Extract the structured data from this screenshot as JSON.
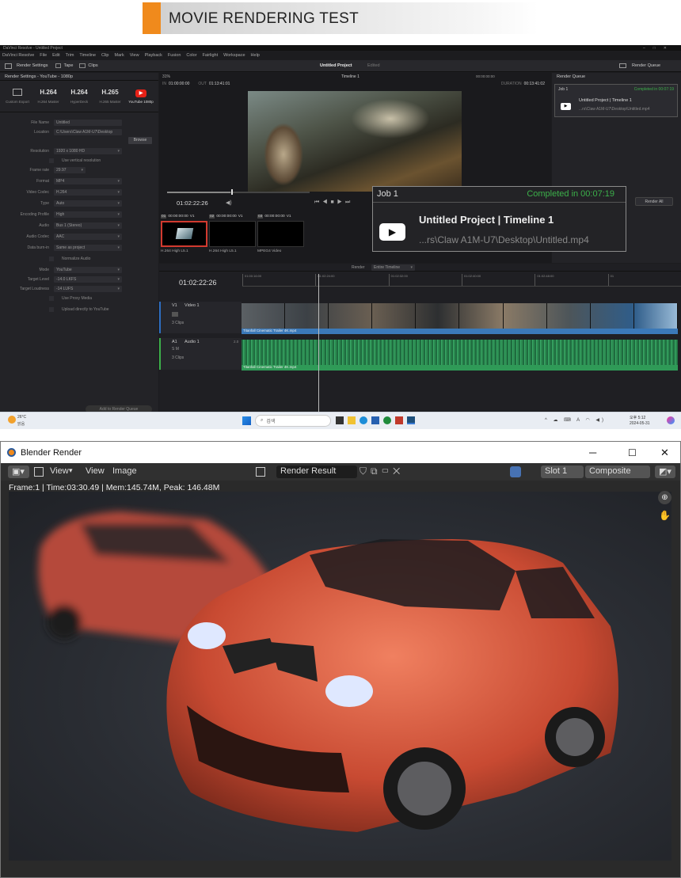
{
  "banner": {
    "title": "MOVIE RENDERING TEST"
  },
  "resolve": {
    "app_title": "DaVinci Resolve - Untitled Project",
    "menu": [
      "DaVinci Resolve",
      "File",
      "Edit",
      "Trim",
      "Timeline",
      "Clip",
      "Mark",
      "View",
      "Playback",
      "Fusion",
      "Color",
      "Fairlight",
      "Workspace",
      "Help"
    ],
    "toolbar": {
      "render_settings": "Render Settings",
      "tape": "Tape",
      "clips": "Clips",
      "project": "Untitled Project",
      "edited": "Edited",
      "timeline": "Timeline 1",
      "render_queue": "Render Queue"
    },
    "render_settings": {
      "header": "Render Settings - YouTube - 1080p",
      "presets": [
        {
          "big": "",
          "small": "Custom Export"
        },
        {
          "big": "H.264",
          "small": "H.264 Master"
        },
        {
          "big": "H.264",
          "small": "HyperDeck"
        },
        {
          "big": "H.265",
          "small": "H.265 Master"
        },
        {
          "big": "",
          "small": "YouTube 1080p"
        }
      ],
      "fields": [
        {
          "label": "File Name",
          "value": "Untitled"
        },
        {
          "label": "Location",
          "value": "C:\\Users\\Claw A1M-U7\\Desktop"
        },
        {
          "label": "Resolution",
          "value": "1920 x 1080 HD"
        },
        {
          "label": "",
          "value": "Use vertical resolution"
        },
        {
          "label": "Frame rate",
          "value": "29.97"
        },
        {
          "label": "Format",
          "value": "MP4"
        },
        {
          "label": "Video Codec",
          "value": "H.264"
        },
        {
          "label": "Type",
          "value": "Auto"
        },
        {
          "label": "Encoding Profile",
          "value": "High"
        },
        {
          "label": "Audio",
          "value": "Bus 1 (Stereo)"
        },
        {
          "label": "Audio Codec",
          "value": "AAC"
        },
        {
          "label": "Data burn-in",
          "value": "Same as project"
        },
        {
          "label": "",
          "value": "Normalize Audio"
        },
        {
          "label": "Mode",
          "value": "YouTube"
        },
        {
          "label": "Target Level",
          "value": "-14.0   LKFS"
        },
        {
          "label": "Target Loudness",
          "value": "-14   LUFS"
        },
        {
          "label": "",
          "value": "Use Proxy Media"
        },
        {
          "label": "",
          "value": "Upload directly to YouTube"
        }
      ],
      "browse": "Browse",
      "add_queue": "Add to Render Queue"
    },
    "viewer": {
      "zoom": "31%",
      "in_label": "IN",
      "in": "01:00:00:00",
      "out_label": "OUT",
      "out": "01:13:41:01",
      "duration_label": "DURATION",
      "duration": "00:13:41:02",
      "tc": "01:02:22:26",
      "tc2": "00:00:00:00"
    },
    "clips": [
      {
        "num": "01",
        "tc": "00:00:00:00",
        "track": "V1",
        "name": "H.264 High L5.1"
      },
      {
        "num": "02",
        "tc": "00:00:00:00",
        "track": "V1",
        "name": "H.264 High L5.1"
      },
      {
        "num": "03",
        "tc": "00:00:00:00",
        "track": "V1",
        "name": "MPEG4 Video"
      }
    ],
    "timeline": {
      "render_label": "Render",
      "render_value": "Entire Timeline",
      "tc": "01:02:22:26",
      "ruler": [
        "01:00:16:00",
        "01:02:24:00",
        "01:02:32:00",
        "01:02:40:00",
        "01:02:48:00",
        "01"
      ],
      "video": {
        "id": "V1",
        "name": "Video 1",
        "clips": "3 Clips",
        "clip_name": "Titanfall Cinematic Trailer 4K.mp4"
      },
      "audio": {
        "id": "A1",
        "name": "Audio 1",
        "level": "2.0",
        "clips": "3 Clips",
        "clip_name": "Titanfall Cinematic Trailer 4K.mp4"
      }
    },
    "queue": {
      "title": "Render Queue",
      "job": "Job 1",
      "status": "Completed in 00:07:19",
      "name": "Untitled Project | Timeline 1",
      "path": "...rs\\Claw A1M-U7\\Desktop\\Untitled.mp4",
      "render_all": "Render All"
    },
    "popup": {
      "job": "Job 1",
      "status": "Completed in 00:07:19",
      "name": "Untitled Project | Timeline 1",
      "path": "...rs\\Claw A1M-U7\\Desktop\\Untitled.mp4"
    }
  },
  "taskbar": {
    "temp": "26°C",
    "weather": "맑음",
    "search": "검색",
    "time": "오후 5:12",
    "date": "2024-05-31"
  },
  "blender": {
    "title": "Blender Render",
    "menu": {
      "view1": "View",
      "view2": "View",
      "image": "Image"
    },
    "image_name": "Render Result",
    "slot": "Slot 1",
    "pass": "Composite",
    "info": "Frame:1 | Time:03:30.49 | Mem:145.74M, Peak: 146.48M"
  },
  "colors": {
    "accent_orange": "#f08a1c",
    "completed_green": "#3cb04a",
    "youtube_red": "#e62117",
    "blender_blue": "#4772b3"
  }
}
